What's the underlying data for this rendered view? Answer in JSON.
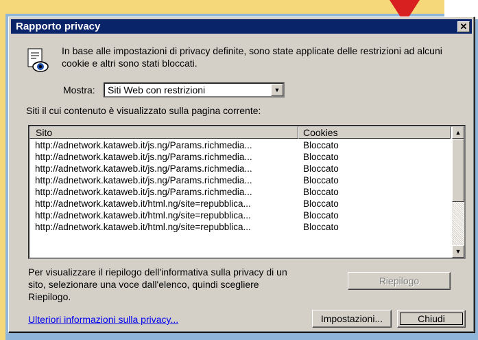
{
  "window": {
    "title": "Rapporto privacy",
    "close_glyph": "✕"
  },
  "intro_text": "In base alle impostazioni di privacy definite, sono state applicate delle restrizioni ad alcuni cookie e altri sono stati bloccati.",
  "filter": {
    "label": "Mostra:",
    "selected": "Siti Web con restrizioni"
  },
  "sites_caption": "Siti il cui contenuto è visualizzato sulla pagina corrente:",
  "table": {
    "headers": {
      "site": "Sito",
      "cookies": "Cookies"
    },
    "rows": [
      {
        "site": "http://adnetwork.kataweb.it/js.ng/Params.richmedia...",
        "cookies": "Bloccato"
      },
      {
        "site": "http://adnetwork.kataweb.it/js.ng/Params.richmedia...",
        "cookies": "Bloccato"
      },
      {
        "site": "http://adnetwork.kataweb.it/js.ng/Params.richmedia...",
        "cookies": "Bloccato"
      },
      {
        "site": "http://adnetwork.kataweb.it/js.ng/Params.richmedia...",
        "cookies": "Bloccato"
      },
      {
        "site": "http://adnetwork.kataweb.it/js.ng/Params.richmedia...",
        "cookies": "Bloccato"
      },
      {
        "site": "http://adnetwork.kataweb.it/html.ng/site=repubblica...",
        "cookies": "Bloccato"
      },
      {
        "site": "http://adnetwork.kataweb.it/html.ng/site=repubblica...",
        "cookies": "Bloccato"
      },
      {
        "site": "http://adnetwork.kataweb.it/html.ng/site=repubblica...",
        "cookies": "Bloccato"
      }
    ]
  },
  "summary_text": "Per visualizzare il riepilogo dell'informativa sulla privacy di un sito, selezionare una voce dall'elenco, quindi scegliere Riepilogo.",
  "buttons": {
    "summary": "Riepilogo",
    "settings": "Impostazioni...",
    "close": "Chiudi"
  },
  "more_info_link": "Ulteriori informazioni sulla privacy...",
  "colors": {
    "titlebar": "#0a246a",
    "dialog_bg": "#d4d0c8",
    "background": "#8fb6d8",
    "accent_yellow": "#f5d879",
    "arrow_red": "#d82020",
    "link": "#0000ee"
  },
  "icons": {
    "privacy": "privacy-report-icon",
    "dropdown": "chevron-down-icon",
    "scroll_up": "scroll-up-icon",
    "scroll_down": "scroll-down-icon"
  }
}
